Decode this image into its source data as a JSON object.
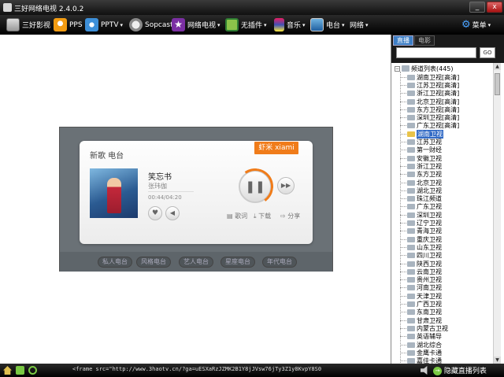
{
  "window": {
    "title": "三好网络电视 2.4.0.2",
    "min_label": "_",
    "close_label": "x"
  },
  "toolbar": {
    "items": [
      {
        "label": "三好影视"
      },
      {
        "label": "PPS"
      },
      {
        "label": "PPTV",
        "dropdown": "▾"
      },
      {
        "label": "Sopcast"
      },
      {
        "label": "网络电视",
        "dropdown": "▾"
      },
      {
        "label": "无插件",
        "dropdown": "▾"
      },
      {
        "label": "音乐",
        "dropdown": "▾"
      },
      {
        "label": "电台",
        "dropdown": "▾"
      },
      {
        "label": "网络",
        "dropdown": "▾"
      }
    ],
    "menu": {
      "label": "菜单",
      "dropdown": "▾"
    }
  },
  "player": {
    "header": "新歌 电台",
    "brand": "虾米 xiami",
    "song_title": "笑忘书",
    "artist": "张玮伽",
    "time": "00:44/04:20",
    "play_glyph": "❚❚",
    "next_glyph": "▶▶",
    "like_glyph": "♥",
    "volume_glyph": "◀",
    "actions": [
      "▤ 歌词",
      "⤓ 下载",
      "⇨ 分享"
    ],
    "stations": [
      "私人电台",
      "风格电台",
      "艺人电台",
      "星座电台",
      "年代电台"
    ]
  },
  "sidebar": {
    "tabs": [
      "直播",
      "电影"
    ],
    "search_value": "",
    "go_label": "GO",
    "tree_root": "频道列表(445)",
    "channels": [
      "湖南卫视[高清]",
      "江苏卫视[高清]",
      "浙江卫视[高清]",
      "北京卫视[高清]",
      "东方卫视[高清]",
      "深圳卫视[高清]",
      "广东卫视[高清]",
      "湖南卫视",
      "江苏卫视",
      "第一财经",
      "安徽卫视",
      "浙江卫视",
      "东方卫视",
      "北京卫视",
      "湖北卫视",
      "珠江频道",
      "广东卫视",
      "深圳卫视",
      "辽宁卫视",
      "青海卫视",
      "重庆卫视",
      "山东卫视",
      "四川卫视",
      "陕西卫视",
      "云南卫视",
      "贵州卫视",
      "河南卫视",
      "天津卫视",
      "广西卫视",
      "东南卫视",
      "甘肃卫视",
      "内蒙古卫视",
      "英语辅导",
      "湖北综合",
      "金鹰卡通",
      "嘉佳卡通"
    ],
    "selected_index": 7
  },
  "status": {
    "text": "<frame src=\"http://www.3haotv.cn/?ga=uESXaRzJZMK2B1Y8jJVsw76jTy3Z1y8KvpY8S0",
    "list_button": "隐藏直播列表"
  },
  "colors": {
    "accent": "#f07c1a",
    "selection": "#316ac5",
    "tab_active": "#3d7fc6"
  }
}
